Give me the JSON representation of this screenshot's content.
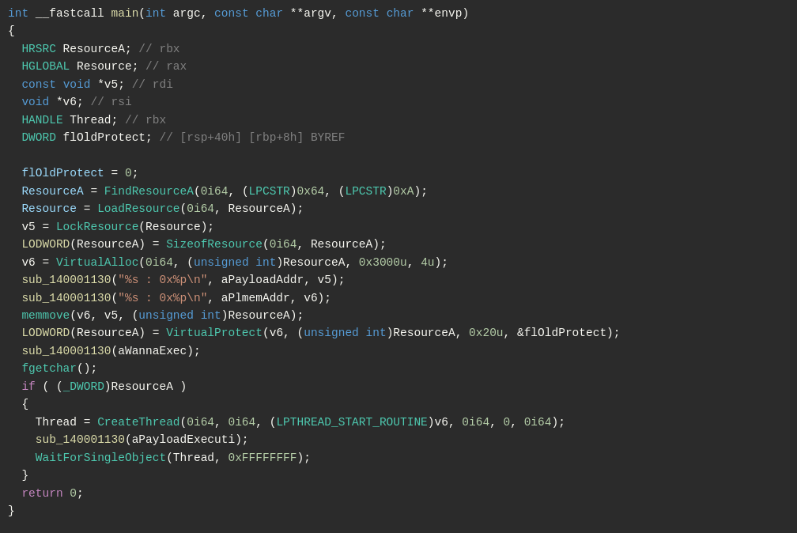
{
  "code": {
    "lines": [
      {
        "id": "line1"
      },
      {
        "id": "line2"
      },
      {
        "id": "line3"
      },
      {
        "id": "line4"
      },
      {
        "id": "line5"
      },
      {
        "id": "line6"
      },
      {
        "id": "line7"
      },
      {
        "id": "line8"
      },
      {
        "id": "line9"
      },
      {
        "id": "line10"
      }
    ]
  }
}
